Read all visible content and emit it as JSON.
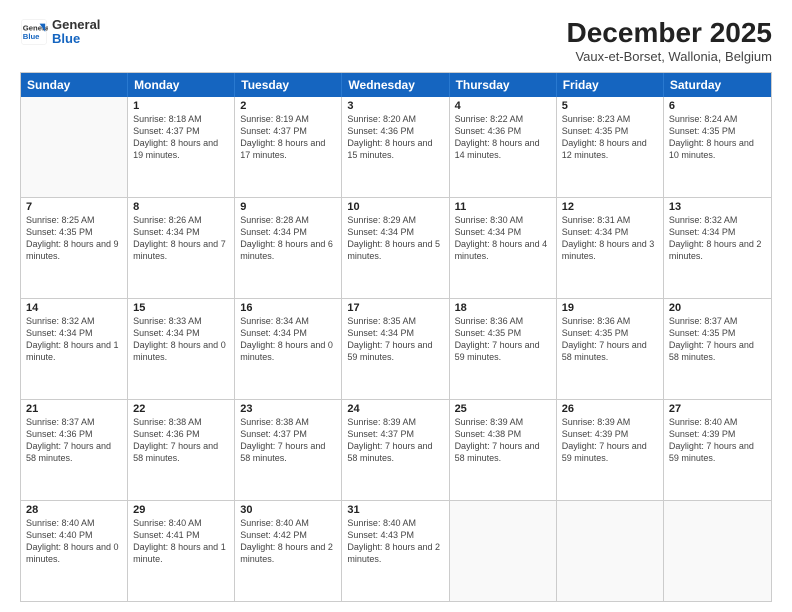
{
  "logo": {
    "general": "General",
    "blue": "Blue"
  },
  "header": {
    "title": "December 2025",
    "subtitle": "Vaux-et-Borset, Wallonia, Belgium"
  },
  "days_of_week": [
    "Sunday",
    "Monday",
    "Tuesday",
    "Wednesday",
    "Thursday",
    "Friday",
    "Saturday"
  ],
  "weeks": [
    [
      {
        "day": "",
        "sunrise": "",
        "sunset": "",
        "daylight": ""
      },
      {
        "day": "1",
        "sunrise": "Sunrise: 8:18 AM",
        "sunset": "Sunset: 4:37 PM",
        "daylight": "Daylight: 8 hours and 19 minutes."
      },
      {
        "day": "2",
        "sunrise": "Sunrise: 8:19 AM",
        "sunset": "Sunset: 4:37 PM",
        "daylight": "Daylight: 8 hours and 17 minutes."
      },
      {
        "day": "3",
        "sunrise": "Sunrise: 8:20 AM",
        "sunset": "Sunset: 4:36 PM",
        "daylight": "Daylight: 8 hours and 15 minutes."
      },
      {
        "day": "4",
        "sunrise": "Sunrise: 8:22 AM",
        "sunset": "Sunset: 4:36 PM",
        "daylight": "Daylight: 8 hours and 14 minutes."
      },
      {
        "day": "5",
        "sunrise": "Sunrise: 8:23 AM",
        "sunset": "Sunset: 4:35 PM",
        "daylight": "Daylight: 8 hours and 12 minutes."
      },
      {
        "day": "6",
        "sunrise": "Sunrise: 8:24 AM",
        "sunset": "Sunset: 4:35 PM",
        "daylight": "Daylight: 8 hours and 10 minutes."
      }
    ],
    [
      {
        "day": "7",
        "sunrise": "Sunrise: 8:25 AM",
        "sunset": "Sunset: 4:35 PM",
        "daylight": "Daylight: 8 hours and 9 minutes."
      },
      {
        "day": "8",
        "sunrise": "Sunrise: 8:26 AM",
        "sunset": "Sunset: 4:34 PM",
        "daylight": "Daylight: 8 hours and 7 minutes."
      },
      {
        "day": "9",
        "sunrise": "Sunrise: 8:28 AM",
        "sunset": "Sunset: 4:34 PM",
        "daylight": "Daylight: 8 hours and 6 minutes."
      },
      {
        "day": "10",
        "sunrise": "Sunrise: 8:29 AM",
        "sunset": "Sunset: 4:34 PM",
        "daylight": "Daylight: 8 hours and 5 minutes."
      },
      {
        "day": "11",
        "sunrise": "Sunrise: 8:30 AM",
        "sunset": "Sunset: 4:34 PM",
        "daylight": "Daylight: 8 hours and 4 minutes."
      },
      {
        "day": "12",
        "sunrise": "Sunrise: 8:31 AM",
        "sunset": "Sunset: 4:34 PM",
        "daylight": "Daylight: 8 hours and 3 minutes."
      },
      {
        "day": "13",
        "sunrise": "Sunrise: 8:32 AM",
        "sunset": "Sunset: 4:34 PM",
        "daylight": "Daylight: 8 hours and 2 minutes."
      }
    ],
    [
      {
        "day": "14",
        "sunrise": "Sunrise: 8:32 AM",
        "sunset": "Sunset: 4:34 PM",
        "daylight": "Daylight: 8 hours and 1 minute."
      },
      {
        "day": "15",
        "sunrise": "Sunrise: 8:33 AM",
        "sunset": "Sunset: 4:34 PM",
        "daylight": "Daylight: 8 hours and 0 minutes."
      },
      {
        "day": "16",
        "sunrise": "Sunrise: 8:34 AM",
        "sunset": "Sunset: 4:34 PM",
        "daylight": "Daylight: 8 hours and 0 minutes."
      },
      {
        "day": "17",
        "sunrise": "Sunrise: 8:35 AM",
        "sunset": "Sunset: 4:34 PM",
        "daylight": "Daylight: 7 hours and 59 minutes."
      },
      {
        "day": "18",
        "sunrise": "Sunrise: 8:36 AM",
        "sunset": "Sunset: 4:35 PM",
        "daylight": "Daylight: 7 hours and 59 minutes."
      },
      {
        "day": "19",
        "sunrise": "Sunrise: 8:36 AM",
        "sunset": "Sunset: 4:35 PM",
        "daylight": "Daylight: 7 hours and 58 minutes."
      },
      {
        "day": "20",
        "sunrise": "Sunrise: 8:37 AM",
        "sunset": "Sunset: 4:35 PM",
        "daylight": "Daylight: 7 hours and 58 minutes."
      }
    ],
    [
      {
        "day": "21",
        "sunrise": "Sunrise: 8:37 AM",
        "sunset": "Sunset: 4:36 PM",
        "daylight": "Daylight: 7 hours and 58 minutes."
      },
      {
        "day": "22",
        "sunrise": "Sunrise: 8:38 AM",
        "sunset": "Sunset: 4:36 PM",
        "daylight": "Daylight: 7 hours and 58 minutes."
      },
      {
        "day": "23",
        "sunrise": "Sunrise: 8:38 AM",
        "sunset": "Sunset: 4:37 PM",
        "daylight": "Daylight: 7 hours and 58 minutes."
      },
      {
        "day": "24",
        "sunrise": "Sunrise: 8:39 AM",
        "sunset": "Sunset: 4:37 PM",
        "daylight": "Daylight: 7 hours and 58 minutes."
      },
      {
        "day": "25",
        "sunrise": "Sunrise: 8:39 AM",
        "sunset": "Sunset: 4:38 PM",
        "daylight": "Daylight: 7 hours and 58 minutes."
      },
      {
        "day": "26",
        "sunrise": "Sunrise: 8:39 AM",
        "sunset": "Sunset: 4:39 PM",
        "daylight": "Daylight: 7 hours and 59 minutes."
      },
      {
        "day": "27",
        "sunrise": "Sunrise: 8:40 AM",
        "sunset": "Sunset: 4:39 PM",
        "daylight": "Daylight: 7 hours and 59 minutes."
      }
    ],
    [
      {
        "day": "28",
        "sunrise": "Sunrise: 8:40 AM",
        "sunset": "Sunset: 4:40 PM",
        "daylight": "Daylight: 8 hours and 0 minutes."
      },
      {
        "day": "29",
        "sunrise": "Sunrise: 8:40 AM",
        "sunset": "Sunset: 4:41 PM",
        "daylight": "Daylight: 8 hours and 1 minute."
      },
      {
        "day": "30",
        "sunrise": "Sunrise: 8:40 AM",
        "sunset": "Sunset: 4:42 PM",
        "daylight": "Daylight: 8 hours and 2 minutes."
      },
      {
        "day": "31",
        "sunrise": "Sunrise: 8:40 AM",
        "sunset": "Sunset: 4:43 PM",
        "daylight": "Daylight: 8 hours and 2 minutes."
      },
      {
        "day": "",
        "sunrise": "",
        "sunset": "",
        "daylight": ""
      },
      {
        "day": "",
        "sunrise": "",
        "sunset": "",
        "daylight": ""
      },
      {
        "day": "",
        "sunrise": "",
        "sunset": "",
        "daylight": ""
      }
    ]
  ]
}
